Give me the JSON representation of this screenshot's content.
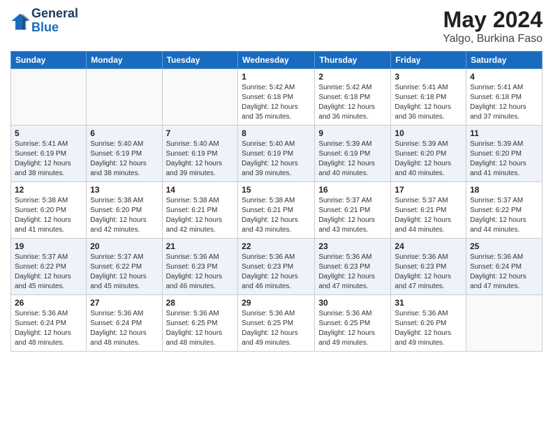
{
  "header": {
    "logo_line1": "General",
    "logo_line2": "Blue",
    "month": "May 2024",
    "location": "Yalgo, Burkina Faso"
  },
  "weekdays": [
    "Sunday",
    "Monday",
    "Tuesday",
    "Wednesday",
    "Thursday",
    "Friday",
    "Saturday"
  ],
  "weeks": [
    [
      {
        "day": "",
        "info": ""
      },
      {
        "day": "",
        "info": ""
      },
      {
        "day": "",
        "info": ""
      },
      {
        "day": "1",
        "info": "Sunrise: 5:42 AM\nSunset: 6:18 PM\nDaylight: 12 hours\nand 35 minutes."
      },
      {
        "day": "2",
        "info": "Sunrise: 5:42 AM\nSunset: 6:18 PM\nDaylight: 12 hours\nand 36 minutes."
      },
      {
        "day": "3",
        "info": "Sunrise: 5:41 AM\nSunset: 6:18 PM\nDaylight: 12 hours\nand 36 minutes."
      },
      {
        "day": "4",
        "info": "Sunrise: 5:41 AM\nSunset: 6:18 PM\nDaylight: 12 hours\nand 37 minutes."
      }
    ],
    [
      {
        "day": "5",
        "info": "Sunrise: 5:41 AM\nSunset: 6:19 PM\nDaylight: 12 hours\nand 38 minutes."
      },
      {
        "day": "6",
        "info": "Sunrise: 5:40 AM\nSunset: 6:19 PM\nDaylight: 12 hours\nand 38 minutes."
      },
      {
        "day": "7",
        "info": "Sunrise: 5:40 AM\nSunset: 6:19 PM\nDaylight: 12 hours\nand 39 minutes."
      },
      {
        "day": "8",
        "info": "Sunrise: 5:40 AM\nSunset: 6:19 PM\nDaylight: 12 hours\nand 39 minutes."
      },
      {
        "day": "9",
        "info": "Sunrise: 5:39 AM\nSunset: 6:19 PM\nDaylight: 12 hours\nand 40 minutes."
      },
      {
        "day": "10",
        "info": "Sunrise: 5:39 AM\nSunset: 6:20 PM\nDaylight: 12 hours\nand 40 minutes."
      },
      {
        "day": "11",
        "info": "Sunrise: 5:39 AM\nSunset: 6:20 PM\nDaylight: 12 hours\nand 41 minutes."
      }
    ],
    [
      {
        "day": "12",
        "info": "Sunrise: 5:38 AM\nSunset: 6:20 PM\nDaylight: 12 hours\nand 41 minutes."
      },
      {
        "day": "13",
        "info": "Sunrise: 5:38 AM\nSunset: 6:20 PM\nDaylight: 12 hours\nand 42 minutes."
      },
      {
        "day": "14",
        "info": "Sunrise: 5:38 AM\nSunset: 6:21 PM\nDaylight: 12 hours\nand 42 minutes."
      },
      {
        "day": "15",
        "info": "Sunrise: 5:38 AM\nSunset: 6:21 PM\nDaylight: 12 hours\nand 43 minutes."
      },
      {
        "day": "16",
        "info": "Sunrise: 5:37 AM\nSunset: 6:21 PM\nDaylight: 12 hours\nand 43 minutes."
      },
      {
        "day": "17",
        "info": "Sunrise: 5:37 AM\nSunset: 6:21 PM\nDaylight: 12 hours\nand 44 minutes."
      },
      {
        "day": "18",
        "info": "Sunrise: 5:37 AM\nSunset: 6:22 PM\nDaylight: 12 hours\nand 44 minutes."
      }
    ],
    [
      {
        "day": "19",
        "info": "Sunrise: 5:37 AM\nSunset: 6:22 PM\nDaylight: 12 hours\nand 45 minutes."
      },
      {
        "day": "20",
        "info": "Sunrise: 5:37 AM\nSunset: 6:22 PM\nDaylight: 12 hours\nand 45 minutes."
      },
      {
        "day": "21",
        "info": "Sunrise: 5:36 AM\nSunset: 6:23 PM\nDaylight: 12 hours\nand 46 minutes."
      },
      {
        "day": "22",
        "info": "Sunrise: 5:36 AM\nSunset: 6:23 PM\nDaylight: 12 hours\nand 46 minutes."
      },
      {
        "day": "23",
        "info": "Sunrise: 5:36 AM\nSunset: 6:23 PM\nDaylight: 12 hours\nand 47 minutes."
      },
      {
        "day": "24",
        "info": "Sunrise: 5:36 AM\nSunset: 6:23 PM\nDaylight: 12 hours\nand 47 minutes."
      },
      {
        "day": "25",
        "info": "Sunrise: 5:36 AM\nSunset: 6:24 PM\nDaylight: 12 hours\nand 47 minutes."
      }
    ],
    [
      {
        "day": "26",
        "info": "Sunrise: 5:36 AM\nSunset: 6:24 PM\nDaylight: 12 hours\nand 48 minutes."
      },
      {
        "day": "27",
        "info": "Sunrise: 5:36 AM\nSunset: 6:24 PM\nDaylight: 12 hours\nand 48 minutes."
      },
      {
        "day": "28",
        "info": "Sunrise: 5:36 AM\nSunset: 6:25 PM\nDaylight: 12 hours\nand 48 minutes."
      },
      {
        "day": "29",
        "info": "Sunrise: 5:36 AM\nSunset: 6:25 PM\nDaylight: 12 hours\nand 49 minutes."
      },
      {
        "day": "30",
        "info": "Sunrise: 5:36 AM\nSunset: 6:25 PM\nDaylight: 12 hours\nand 49 minutes."
      },
      {
        "day": "31",
        "info": "Sunrise: 5:36 AM\nSunset: 6:26 PM\nDaylight: 12 hours\nand 49 minutes."
      },
      {
        "day": "",
        "info": ""
      }
    ]
  ]
}
